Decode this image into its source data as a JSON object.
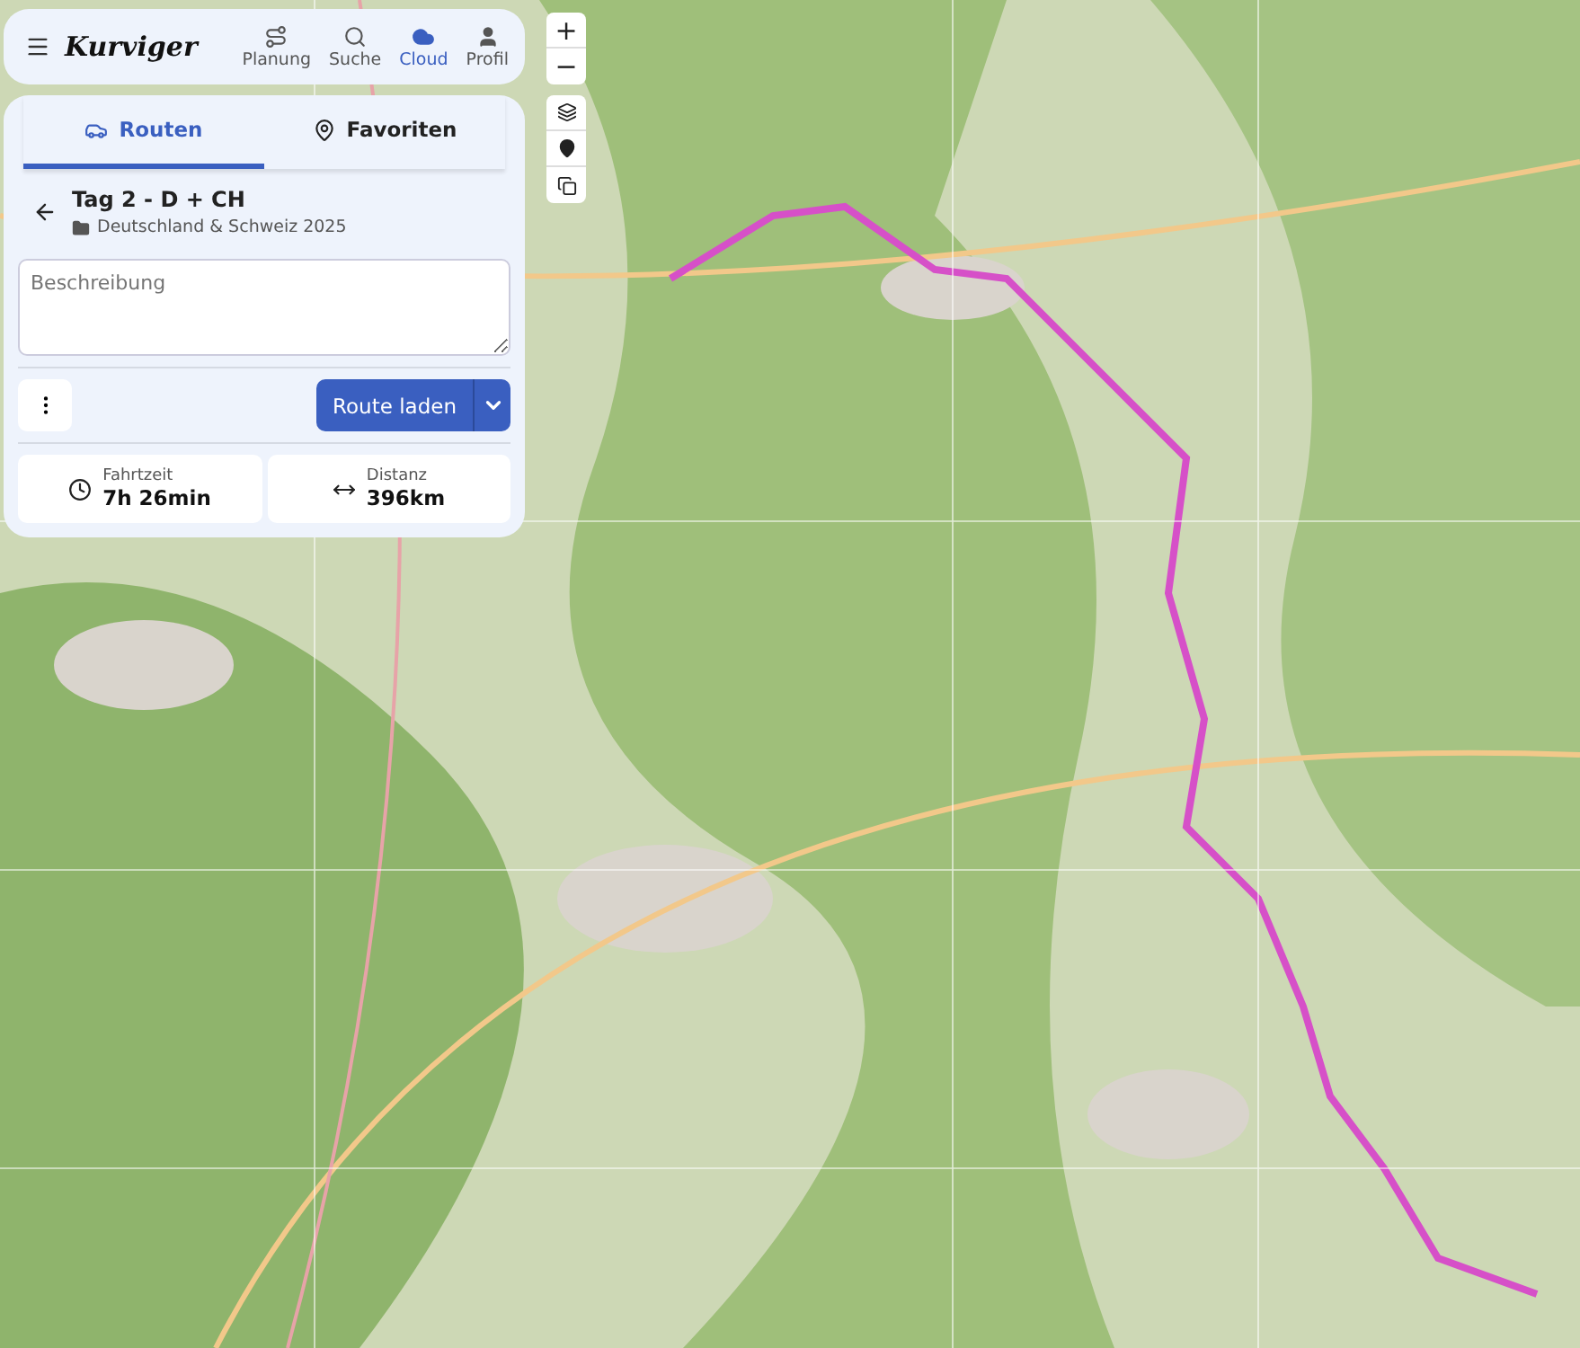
{
  "app": {
    "logo": "Kurviger"
  },
  "nav": [
    {
      "label": "Planung",
      "kind": "route",
      "selected": false
    },
    {
      "label": "Suche",
      "kind": "search",
      "selected": false
    },
    {
      "label": "Cloud",
      "kind": "cloud",
      "selected": true
    },
    {
      "label": "Profil",
      "kind": "user",
      "selected": false
    }
  ],
  "tabs": [
    {
      "label": "Routen",
      "kind": "road",
      "selected": true
    },
    {
      "label": "Favoriten",
      "kind": "pin",
      "selected": false
    }
  ],
  "route": {
    "title": "Tag 2 - D + CH",
    "folder": "Deutschland & Schweiz 2025"
  },
  "description": {
    "placeholder": "Beschreibung"
  },
  "actions": {
    "load": "Route laden"
  },
  "stats": [
    {
      "kind": "clock",
      "label": "Fahrtzeit",
      "value": "7h 26min"
    },
    {
      "kind": "arrows",
      "label": "Distanz",
      "value": "396km"
    }
  ],
  "map_controls": {
    "zoom_in": "+",
    "zoom_out": "−"
  }
}
